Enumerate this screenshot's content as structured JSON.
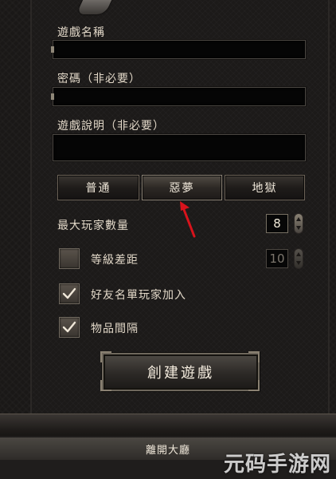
{
  "form": {
    "game_name_label": "遊戲名稱",
    "game_name_value": "",
    "password_label": "密碼（非必要）",
    "password_value": "",
    "description_label": "遊戲說明（非必要）",
    "description_value": ""
  },
  "difficulty": {
    "options": [
      "普通",
      "惡夢",
      "地獄"
    ],
    "selected": "惡夢"
  },
  "max_players": {
    "label": "最大玩家數量",
    "value": "8"
  },
  "level_diff": {
    "label": "等級差距",
    "value": "10",
    "checked": false
  },
  "friends_only": {
    "label": "好友名單玩家加入",
    "checked": true
  },
  "item_spacing": {
    "label": "物品間隔",
    "checked": true
  },
  "buttons": {
    "create_game": "創建遊戲",
    "leave_lobby": "離開大廳"
  },
  "watermark": "元码手游网",
  "colors": {
    "panel_bg": "#1c1a19",
    "text": "#e2d8c8",
    "accent_arrow": "#d8131c"
  },
  "icons": {
    "check": "check-icon",
    "arrow": "pointer-arrow-icon"
  }
}
